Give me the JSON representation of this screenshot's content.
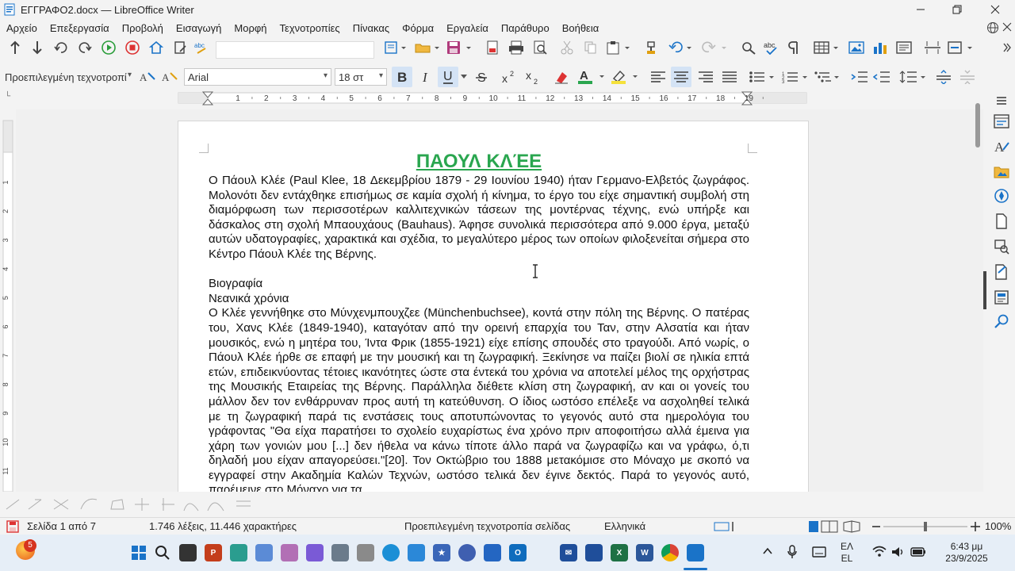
{
  "window": {
    "title": "ΕΓΓΡΑΦΟ2.docx — LibreOffice Writer"
  },
  "menu": [
    "Αρχείο",
    "Επεξεργασία",
    "Προβολή",
    "Εισαγωγή",
    "Μορφή",
    "Τεχνοτροπίες",
    "Πίνακας",
    "Φόρμα",
    "Εργαλεία",
    "Παράθυρο",
    "Βοήθεια"
  ],
  "format": {
    "paragraph_style": "Προεπιλεγμένη τεχνοτροπί",
    "font_name": "Arial",
    "font_size": "18 στ"
  },
  "ruler": {
    "ticks": [
      "1",
      "2",
      "3",
      "4",
      "5",
      "6",
      "7",
      "8",
      "9",
      "10",
      "11",
      "12",
      "13",
      "14",
      "15",
      "16",
      "17",
      "18",
      "19"
    ]
  },
  "vruler": {
    "ticks": [
      "1",
      "2",
      "3",
      "4",
      "5",
      "6",
      "7",
      "8",
      "9",
      "10",
      "11"
    ]
  },
  "document": {
    "title": "ΠΑΟΥΛ ΚΛΈΕ",
    "intro": "Ο Πάουλ Κλέε (Paul Klee, 18 Δεκεμβρίου 1879 - 29 Ιουνίου 1940) ήταν Γερμανο-Ελβετός ζωγράφος. Μολονότι δεν εντάχθηκε επισήμως σε καμία σχολή ή κίνημα, το έργο του είχε σημαντική συμβολή στη διαμόρφωση των περισσοτέρων καλλιτεχνικών τάσεων της μοντέρνας τέχνης, ενώ υπήρξε και δάσκαλος στη σχολή Μπαουχάους (Bauhaus). Άφησε συνολικά περισσότερα από 9.000 έργα, μεταξύ αυτών υδατογραφίες, χαρακτικά και σχέδια, το μεγαλύτερο μέρος των οποίων φιλοξενείται σήμερα στο Κέντρο Πάουλ Κλέε της Βέρνης.",
    "heading1": "Βιογραφία",
    "heading2": "Νεανικά χρόνια",
    "body": "Ο Κλέε γεννήθηκε στο Μύνχενμπουχζεε (Münchenbuchsee), κοντά στην πόλη της Βέρνης. Ο πατέρας του, Χανς Κλέε (1849-1940), καταγόταν από την ορεινή επαρχία του Ταν, στην Αλσατία και ήταν μουσικός, ενώ η μητέρα του, Ίντα Φρικ (1855-1921) είχε επίσης σπουδές στο τραγούδι. Από νωρίς, ο Πάουλ Κλέε ήρθε σε επαφή με την μουσική και τη ζωγραφική. Ξεκίνησε να παίζει βιολί σε ηλικία επτά ετών, επιδεικνύοντας τέτοιες ικανότητες ώστε στα έντεκά του χρόνια να αποτελεί μέλος της ορχήστρας της Μουσικής Εταιρείας της Βέρνης. Παράλληλα διέθετε κλίση στη ζωγραφική, αν και οι γονείς του μάλλον δεν τον ενθάρρυναν προς αυτή τη κατεύθυνση. Ο ίδιος ωστόσο επέλεξε να ασχοληθεί τελικά με τη ζωγραφική παρά τις ενστάσεις τους αποτυπώνοντας το γεγονός αυτό στα ημερολόγια του γράφοντας \"Θα είχα παρατήσει το σχολείο ευχαρίστως ένα χρόνο πριν αποφοιτήσω αλλά έμεινα για χάρη των γονιών μου [...] δεν ήθελα να κάνω τίποτε άλλο παρά να ζωγραφίζω και να γράφω, ό,τι δηλαδή μου είχαν απαγορεύσει.\"[20]. Τον Οκτώβριο του 1888 μετακόμισε στο Μόναχο με σκοπό να εγγραφεί στην Ακαδημία Καλών Τεχνών, ωστόσο τελικά δεν έγινε δεκτός. Παρά το γεγονός αυτό, παρέμεινε στο Μόναχο για τα"
  },
  "status": {
    "page": "Σελίδα 1 από 7",
    "words": "1.746 λέξεις, 11.446 χαρακτήρες",
    "page_style": "Προεπιλεγμένη τεχνοτροπία σελίδας",
    "language": "Ελληνικά",
    "zoom": "100%"
  },
  "taskbar": {
    "badge": "5",
    "lang_top": "ΕΛ",
    "lang_bottom": "EL",
    "time": "6:43 μμ",
    "date": "23/9/2025"
  },
  "colors": {
    "title_green": "#2aa64f",
    "accent": "#1a73c8"
  }
}
